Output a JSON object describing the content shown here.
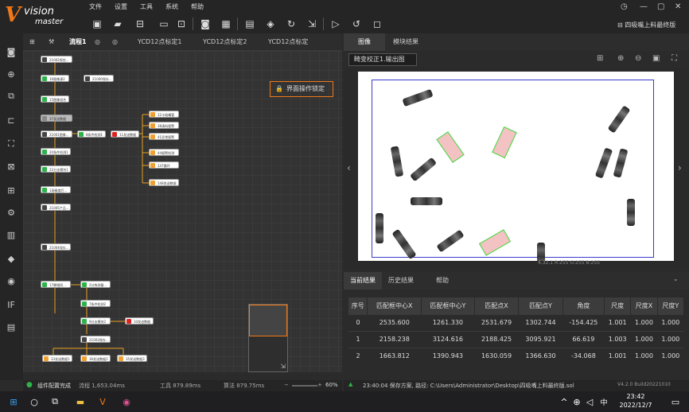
{
  "app": {
    "logo_v": "V",
    "logo_line1": "vision",
    "logo_line2": "master",
    "solution_name": "四吸嘴上料最终版"
  },
  "menu": [
    "文件",
    "设置",
    "工具",
    "系统",
    "帮助"
  ],
  "left_tabs": {
    "flow": "流程1",
    "t1": "YCD12点标定1",
    "t2": "YCD12点标定2",
    "t3": "YCD12点标定"
  },
  "lock_label": "界面操作锁定",
  "nodes": [
    {
      "label": "21002保信...",
      "c": "#444"
    },
    {
      "label": "16图像源2",
      "c": "#2db34a"
    },
    {
      "label": "21000保存...",
      "c": "#444"
    },
    {
      "label": "15图像组合",
      "c": "#2db34a"
    },
    {
      "label": "37发送数据",
      "c": "#aaa"
    },
    {
      "label": "21001图像...",
      "c": "#444"
    },
    {
      "label": "8条件检测1",
      "c": "#2db34a"
    },
    {
      "label": "11发送数据",
      "c": "#d22"
    },
    {
      "label": "12卡吸嘴管",
      "c": "#f0a030"
    },
    {
      "label": "38清料报警",
      "c": "#f0a030"
    },
    {
      "label": "41异常报警",
      "c": "#f0a030"
    },
    {
      "label": "44报警检测",
      "c": "#f0a030"
    },
    {
      "label": "147循环",
      "c": "#f0a030"
    },
    {
      "label": "148发送数据",
      "c": "#f0a030"
    },
    {
      "label": "20条件检测1",
      "c": "#2db34a"
    },
    {
      "label": "22分支模块1",
      "c": "#2db34a"
    },
    {
      "label": "1高精度匹...",
      "c": "#2db34a"
    },
    {
      "label": "21005产品...",
      "c": "#444"
    },
    {
      "label": "21004保存...",
      "c": "#444"
    },
    {
      "label": "17脚相同...",
      "c": "#2db34a"
    },
    {
      "label": "2分拣测量...",
      "c": "#2db34a"
    },
    {
      "label": "7条件检测2",
      "c": "#2db34a"
    },
    {
      "label": "9分支模块2",
      "c": "#2db34a"
    },
    {
      "label": "10发送数据",
      "c": "#d22"
    },
    {
      "label": "21003保存...",
      "c": "#444"
    },
    {
      "label": "33发送数据1",
      "c": "#f0a030"
    },
    {
      "label": "36发送数据2",
      "c": "#f0a030"
    },
    {
      "label": "35发送数据3",
      "c": "#f0a030"
    }
  ],
  "left_status": {
    "status": "组件配置完成",
    "flow_time": "流程 1,653.04ms",
    "tool_time": "工具 879.89ms",
    "algo_time": "算法 879.75ms",
    "zoom": "60%"
  },
  "right_tabs": {
    "image": "图像",
    "module_result": "模块结果"
  },
  "image_source": "畸变校正1.输出图",
  "pixel_info": "4,32,1 R:255 G:255 B:255",
  "result_tabs": {
    "current": "当前结果",
    "history": "历史结果",
    "help": "帮助"
  },
  "table": {
    "headers": [
      "序号",
      "匹配框中心X",
      "匹配框中心Y",
      "匹配点X",
      "匹配点Y",
      "角度",
      "尺度",
      "尺度X",
      "尺度Y"
    ],
    "rows": [
      [
        "0",
        "2535.600",
        "1261.330",
        "2531.679",
        "1302.744",
        "-154.425",
        "1.001",
        "1.000",
        "1.000"
      ],
      [
        "1",
        "2158.238",
        "3124.616",
        "2188.425",
        "3095.921",
        "66.619",
        "1.003",
        "1.000",
        "1.000"
      ],
      [
        "2",
        "1663.812",
        "1390.943",
        "1630.059",
        "1366.630",
        "-34.068",
        "1.001",
        "1.000",
        "1.000"
      ]
    ]
  },
  "right_status": {
    "message": "23:40:04 保存方案, 路径: C:\\Users\\Administrator\\Desktop\\四吸嘴上料最终版.sol",
    "version": "V4.2.0 Build20221010"
  },
  "taskbar": {
    "ime": "中",
    "time": "23:42",
    "date": "2022/12/7"
  }
}
